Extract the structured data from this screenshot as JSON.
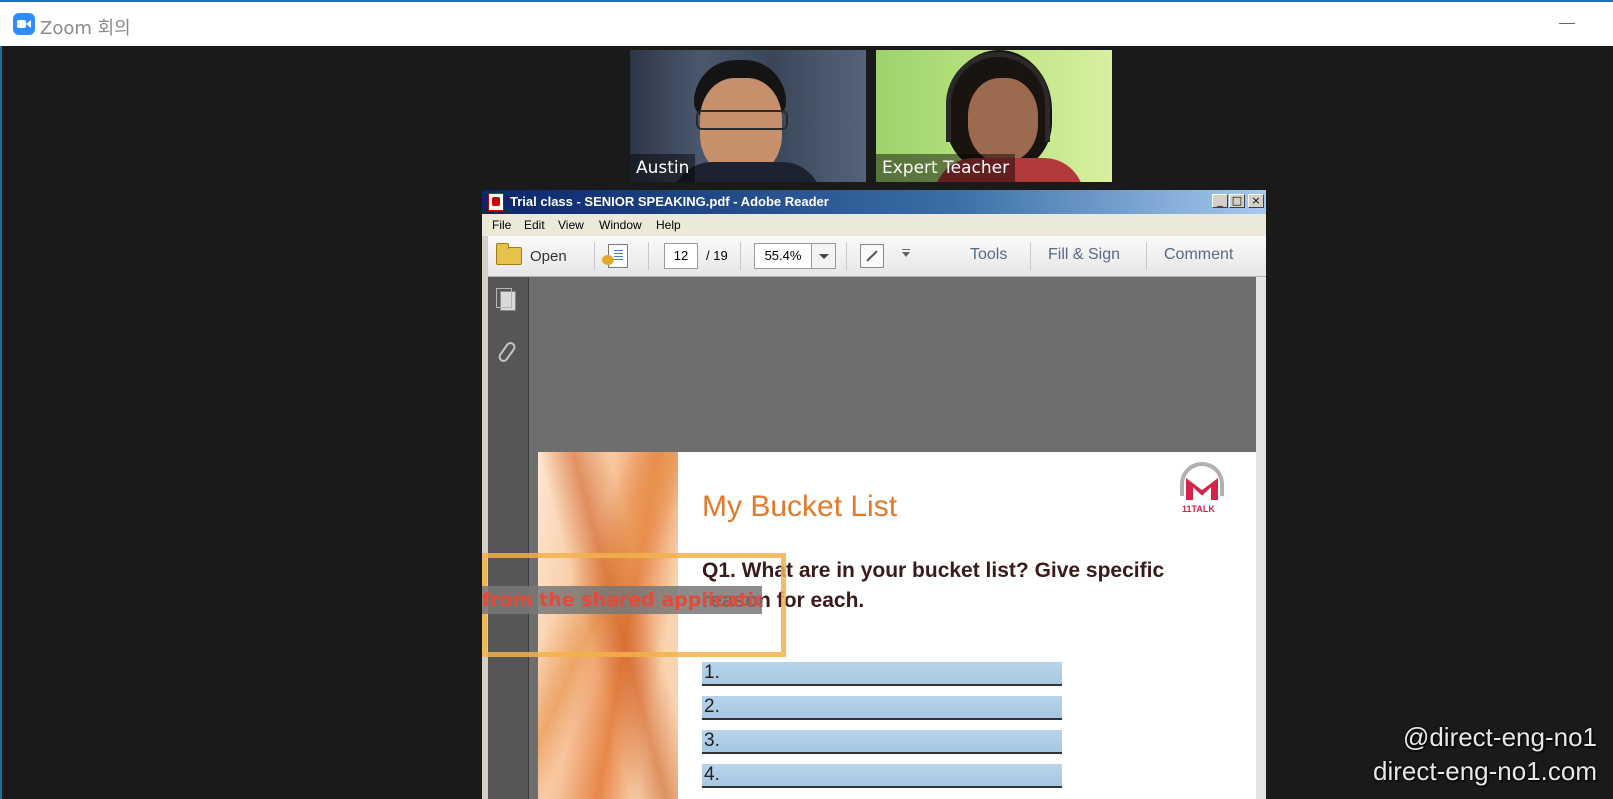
{
  "zoom": {
    "title": "Zoom 회의"
  },
  "participants": [
    {
      "name": "Austin"
    },
    {
      "name": "Expert Teacher"
    }
  ],
  "reader": {
    "title": "Trial class - SENIOR SPEAKING.pdf - Adobe Reader",
    "window_buttons": {
      "minimize": "_",
      "maximize": "□",
      "close": "×"
    },
    "menu": [
      "File",
      "Edit",
      "View",
      "Window",
      "Help"
    ],
    "toolbar": {
      "open_label": "Open",
      "page_current": "12",
      "page_total": "/ 19",
      "zoom_level": "55.4%",
      "tools_label": "Tools",
      "fill_sign_label": "Fill & Sign",
      "comment_label": "Comment"
    }
  },
  "pdf_page": {
    "heading": "My Bucket List",
    "logo_text": "11TALK",
    "question": "Q1. What are in your bucket list? Give specific reason for each.",
    "answers": [
      "1.",
      "2.",
      "3.",
      "4."
    ]
  },
  "share_notice": "from the shared application",
  "watermark": {
    "handle": "@direct-eng-no1",
    "site": "direct-eng-no1.com"
  },
  "colors": {
    "zoom_blue": "#2d8cff",
    "heading_orange": "#e07a2a",
    "notice_red": "#e24a3a",
    "answer_blue": "#a6c7e2"
  }
}
